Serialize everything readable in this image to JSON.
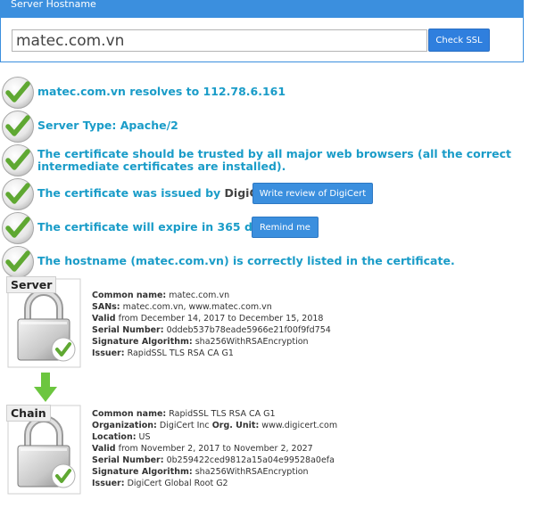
{
  "header": {
    "title": "Server Hostname"
  },
  "search": {
    "hostname": "matec.com.vn",
    "button_label": "Check SSL"
  },
  "results": [
    {
      "text": "matec.com.vn resolves to 112.78.6.161"
    },
    {
      "text": "Server Type: Apache/2"
    },
    {
      "text": "The certificate should be trusted by all major web browsers (all the correct intermediate certificates are installed)."
    },
    {
      "text": "The certificate was issued by ",
      "strong": "DigiCert",
      "after": ".",
      "button": "Write review of DigiCert"
    },
    {
      "text": "The certificate will expire in 365 days.",
      "button": "Remind me"
    },
    {
      "text": "The hostname (matec.com.vn) is correctly listed in the certificate."
    }
  ],
  "server_cert": {
    "badge": "Server",
    "fields": [
      {
        "label": "Common name:",
        "value": "matec.com.vn"
      },
      {
        "label": "SANs:",
        "value": "matec.com.vn, www.matec.com.vn"
      },
      {
        "label": "Valid",
        "value": "from December 14, 2017 to December 15, 2018"
      },
      {
        "label": "Serial Number:",
        "value": "0ddeb537b78eade5966e21f00f9fd754"
      },
      {
        "label": "Signature Algorithm:",
        "value": "sha256WithRSAEncryption"
      },
      {
        "label": "Issuer:",
        "value": "RapidSSL TLS RSA CA G1"
      }
    ]
  },
  "chain_cert": {
    "badge": "Chain",
    "fields": [
      {
        "label": "Common name:",
        "value": "RapidSSL TLS RSA CA G1"
      },
      {
        "label": "Organization:",
        "value": "DigiCert Inc",
        "label2": "Org. Unit:",
        "value2": "www.digicert.com"
      },
      {
        "label": "Location:",
        "value": "US"
      },
      {
        "label": "Valid",
        "value": "from November 2, 2017 to November 2, 2027"
      },
      {
        "label": "Serial Number:",
        "value": "0b259422ced9812a15a04e99528a0efa"
      },
      {
        "label": "Signature Algorithm:",
        "value": "sha256WithRSAEncryption"
      },
      {
        "label": "Issuer:",
        "value": "DigiCert Global Root G2"
      }
    ]
  },
  "colors": {
    "accent": "#3b8fde",
    "result_text": "#1a9cc8",
    "check_green": "#5fa832"
  }
}
